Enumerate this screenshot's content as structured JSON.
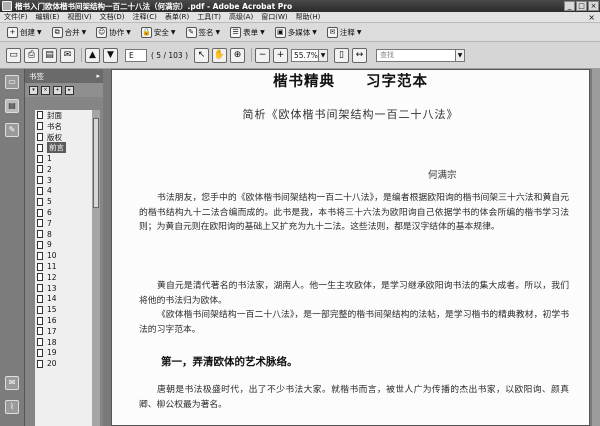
{
  "window": {
    "title": "楷书入门欧体楷书间架结构一百二十八法（何满宗）.pdf - Adobe Acrobat Pro",
    "minimize": "_",
    "maximize": "□",
    "close": "×"
  },
  "menu": {
    "items": [
      "文件(F)",
      "编辑(E)",
      "视图(V)",
      "文档(D)",
      "注释(C)",
      "表单(R)",
      "工具(T)",
      "高级(A)",
      "窗口(W)",
      "帮助(H)"
    ],
    "close": "×"
  },
  "toolbar1": {
    "create": "创建",
    "combine": "合并",
    "collaborate": "协作",
    "secure": "安全",
    "sign": "签名",
    "forms": "表单",
    "multimedia": "多媒体",
    "comment": "注释"
  },
  "toolbar2": {
    "page_value": "E",
    "page_count": "( 5 / 103 )",
    "zoom_value": "55.7%",
    "search_placeholder": "查找"
  },
  "bookmarks": {
    "header": "书签",
    "items": [
      "封面",
      "书名",
      "版权",
      "前言",
      "1",
      "2",
      "3",
      "4",
      "5",
      "6",
      "7",
      "8",
      "9",
      "10",
      "11",
      "12",
      "13",
      "14",
      "15",
      "16",
      "17",
      "18",
      "19",
      "20"
    ],
    "selected_index": 3
  },
  "document": {
    "title": "楷书精典　　习字范本",
    "subtitle": "简析《欧体楷书间架结构一百二十八法》",
    "author": "何满宗",
    "paragraphs": [
      "书法朋友，您手中的《欧体楷书间架结构一百二十八法》，是编者根据欧阳询的楷书间架三十六法和黄自元的楷书结构九十二法合编而成的。此书是我，本书将三十六法为欧阳询自己依据学书的体会所编的楷书学习法则；为黄自元则在欧阳询的基础上又扩充为九十二法。这些法则，都是汉字结体的基本规律。",
      "黄自元是清代著名的书法家，湖南人。他一生主攻欧体，是学习继承欧阳询书法的集大成者。所以，我们将他的书法归为欧体。",
      "《欧体楷书间架结构一百二十八法》，是一部完整的楷书间架结构的法帖，是学习楷书的精典教材，初学书法的习字范本。"
    ],
    "section_heading": "第一，弄清欧体的艺术脉络。",
    "last_paragraph": "唐朝是书法极盛时代，出了不少书法大家。就楷书而言，被世人广为传播的杰出书家，以欧阳询、颜真卿、柳公权最为著名。"
  }
}
